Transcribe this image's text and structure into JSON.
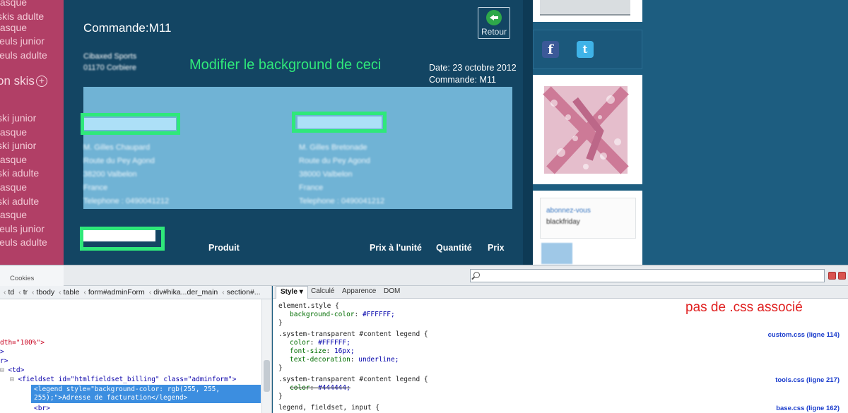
{
  "sidebar": {
    "items": [
      "tasque",
      "skis adulte",
      "tasque",
      "ieuls junior",
      "ieuls adulte"
    ],
    "heading": "on skis",
    "items_bottom": [
      "ski junior",
      "tasque",
      "ski junior",
      "tasque",
      "ski adulte",
      "tasque",
      "ski adulte",
      "tasque",
      "ieuls junior",
      "ieuls adulte"
    ]
  },
  "order": {
    "title": "Commande:M11",
    "back_label": "Retour",
    "shop_name": "Cibaxed Sports",
    "shop_city": "01170 Corbiere",
    "date": "Date: 23 octobre 2012",
    "order_ref": "Commande: M11",
    "billing_lines": [
      "M. Gilles Chaupard",
      "Route du Pey Agond",
      "38200 Valbelon",
      "France",
      "Telephone : 0490041212"
    ],
    "shipping_lines": [
      "M. Gilles Bretonade",
      "Route du Pey Agond",
      "38000 Valbelon",
      "France",
      "Telephone : 0490041212"
    ],
    "columns": [
      "Produit",
      "Prix à l'unité",
      "Quantité",
      "Prix"
    ]
  },
  "annotations": {
    "top": "Modifier le background de ceci",
    "css": "pas de .css associé"
  },
  "right_col": {
    "social": [
      "facebook-icon",
      "twitter-icon"
    ],
    "ad_lines": [
      "abonnez-vous",
      "blackfriday"
    ]
  },
  "devtools": {
    "cookies_tab": "Cookies",
    "breadcrumb": [
      "td",
      "tr",
      "tbody",
      "table",
      "form#adminForm",
      "div#hika...der_main",
      "section#..."
    ],
    "html_lines": {
      "width_attr": "dth=\"100%\">",
      "gt1": ">",
      "gt2": "r>",
      "td": "<td>",
      "fieldset": "<fieldset id=\"htmlfieldset_billing\" class=\"adminform\">",
      "legend_sel_1": "<legend style=\"background-color: rgb(255, 255,",
      "legend_sel_2": "255);\">Adresse de facturation</legend>",
      "br": "<br>"
    },
    "style_tabs": [
      "Style",
      "Calculé",
      "Apparence",
      "DOM"
    ],
    "css_rules": [
      {
        "selector": "element.style {",
        "props": [
          [
            "background-color",
            "#FFFFFF;"
          ]
        ],
        "source": ""
      },
      {
        "selector": ".system-transparent #content legend {",
        "props": [
          [
            "color",
            "#FFFFFF;"
          ],
          [
            "font-size",
            "16px;"
          ],
          [
            "text-decoration",
            "underline;"
          ]
        ],
        "source": "custom.css (ligne 114)"
      },
      {
        "selector": ".system-transparent #content legend {",
        "props": [
          [
            "color",
            "#444444;"
          ]
        ],
        "source": "tools.css (ligne 217)"
      },
      {
        "selector": "legend, fieldset, input {",
        "props": [],
        "source": "base.css (ligne 162)"
      }
    ]
  },
  "colors": {
    "sidebar_pink": "#b13f66",
    "highlight_green": "#2fe87a",
    "annotation_red": "#e02020",
    "selected_blue": "#3c8ee0"
  }
}
